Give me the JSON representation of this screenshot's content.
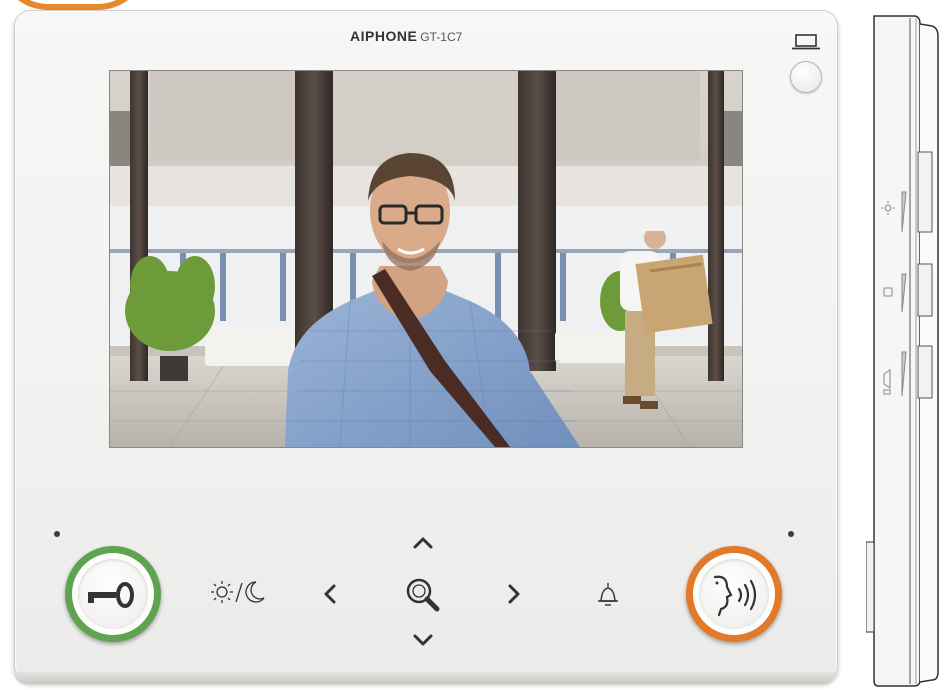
{
  "brand": {
    "name": "AIPHONE",
    "model": "GT-1C7"
  },
  "colors": {
    "door_release_ring": "#5ea350",
    "talk_ring": "#e27a2a",
    "housing": "#f2f2f0"
  },
  "screen": {
    "content": "video-feed"
  },
  "controls": {
    "door_release": {
      "icon": "door-release-key-icon"
    },
    "brightness": {
      "icon": "brightness-day-night-icon"
    },
    "left": {
      "icon": "chevron-left-icon"
    },
    "up": {
      "icon": "chevron-up-icon"
    },
    "zoom": {
      "icon": "zoom-magnifier-icon"
    },
    "down": {
      "icon": "chevron-down-icon"
    },
    "right": {
      "icon": "chevron-right-icon"
    },
    "chime": {
      "icon": "bell-icon"
    },
    "talk": {
      "icon": "talk-icon"
    },
    "top_button": {
      "icon": "monitor-icon"
    }
  },
  "side_view": {
    "buttons": [
      "brightness-icon",
      "volume-icon",
      "call-volume-icon"
    ]
  }
}
